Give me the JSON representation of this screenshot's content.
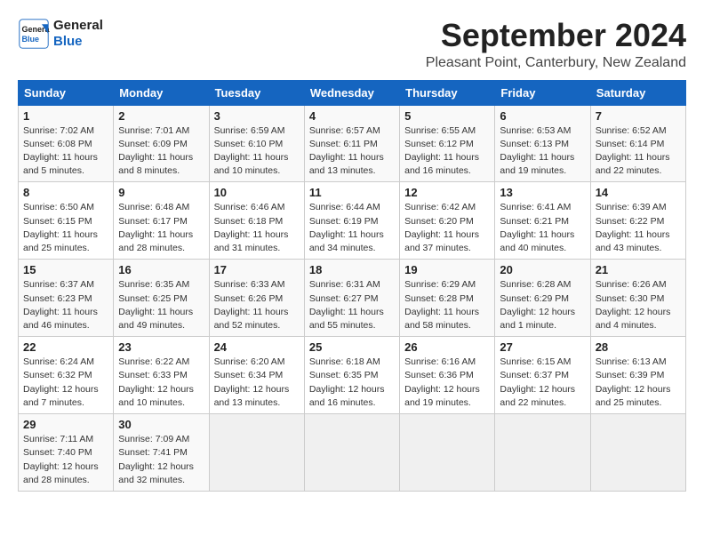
{
  "logo": {
    "line1": "General",
    "line2": "Blue"
  },
  "title": "September 2024",
  "location": "Pleasant Point, Canterbury, New Zealand",
  "days_of_week": [
    "Sunday",
    "Monday",
    "Tuesday",
    "Wednesday",
    "Thursday",
    "Friday",
    "Saturday"
  ],
  "weeks": [
    [
      {
        "day": "1",
        "info": "Sunrise: 7:02 AM\nSunset: 6:08 PM\nDaylight: 11 hours\nand 5 minutes."
      },
      {
        "day": "2",
        "info": "Sunrise: 7:01 AM\nSunset: 6:09 PM\nDaylight: 11 hours\nand 8 minutes."
      },
      {
        "day": "3",
        "info": "Sunrise: 6:59 AM\nSunset: 6:10 PM\nDaylight: 11 hours\nand 10 minutes."
      },
      {
        "day": "4",
        "info": "Sunrise: 6:57 AM\nSunset: 6:11 PM\nDaylight: 11 hours\nand 13 minutes."
      },
      {
        "day": "5",
        "info": "Sunrise: 6:55 AM\nSunset: 6:12 PM\nDaylight: 11 hours\nand 16 minutes."
      },
      {
        "day": "6",
        "info": "Sunrise: 6:53 AM\nSunset: 6:13 PM\nDaylight: 11 hours\nand 19 minutes."
      },
      {
        "day": "7",
        "info": "Sunrise: 6:52 AM\nSunset: 6:14 PM\nDaylight: 11 hours\nand 22 minutes."
      }
    ],
    [
      {
        "day": "8",
        "info": "Sunrise: 6:50 AM\nSunset: 6:15 PM\nDaylight: 11 hours\nand 25 minutes."
      },
      {
        "day": "9",
        "info": "Sunrise: 6:48 AM\nSunset: 6:17 PM\nDaylight: 11 hours\nand 28 minutes."
      },
      {
        "day": "10",
        "info": "Sunrise: 6:46 AM\nSunset: 6:18 PM\nDaylight: 11 hours\nand 31 minutes."
      },
      {
        "day": "11",
        "info": "Sunrise: 6:44 AM\nSunset: 6:19 PM\nDaylight: 11 hours\nand 34 minutes."
      },
      {
        "day": "12",
        "info": "Sunrise: 6:42 AM\nSunset: 6:20 PM\nDaylight: 11 hours\nand 37 minutes."
      },
      {
        "day": "13",
        "info": "Sunrise: 6:41 AM\nSunset: 6:21 PM\nDaylight: 11 hours\nand 40 minutes."
      },
      {
        "day": "14",
        "info": "Sunrise: 6:39 AM\nSunset: 6:22 PM\nDaylight: 11 hours\nand 43 minutes."
      }
    ],
    [
      {
        "day": "15",
        "info": "Sunrise: 6:37 AM\nSunset: 6:23 PM\nDaylight: 11 hours\nand 46 minutes."
      },
      {
        "day": "16",
        "info": "Sunrise: 6:35 AM\nSunset: 6:25 PM\nDaylight: 11 hours\nand 49 minutes."
      },
      {
        "day": "17",
        "info": "Sunrise: 6:33 AM\nSunset: 6:26 PM\nDaylight: 11 hours\nand 52 minutes."
      },
      {
        "day": "18",
        "info": "Sunrise: 6:31 AM\nSunset: 6:27 PM\nDaylight: 11 hours\nand 55 minutes."
      },
      {
        "day": "19",
        "info": "Sunrise: 6:29 AM\nSunset: 6:28 PM\nDaylight: 11 hours\nand 58 minutes."
      },
      {
        "day": "20",
        "info": "Sunrise: 6:28 AM\nSunset: 6:29 PM\nDaylight: 12 hours\nand 1 minute."
      },
      {
        "day": "21",
        "info": "Sunrise: 6:26 AM\nSunset: 6:30 PM\nDaylight: 12 hours\nand 4 minutes."
      }
    ],
    [
      {
        "day": "22",
        "info": "Sunrise: 6:24 AM\nSunset: 6:32 PM\nDaylight: 12 hours\nand 7 minutes."
      },
      {
        "day": "23",
        "info": "Sunrise: 6:22 AM\nSunset: 6:33 PM\nDaylight: 12 hours\nand 10 minutes."
      },
      {
        "day": "24",
        "info": "Sunrise: 6:20 AM\nSunset: 6:34 PM\nDaylight: 12 hours\nand 13 minutes."
      },
      {
        "day": "25",
        "info": "Sunrise: 6:18 AM\nSunset: 6:35 PM\nDaylight: 12 hours\nand 16 minutes."
      },
      {
        "day": "26",
        "info": "Sunrise: 6:16 AM\nSunset: 6:36 PM\nDaylight: 12 hours\nand 19 minutes."
      },
      {
        "day": "27",
        "info": "Sunrise: 6:15 AM\nSunset: 6:37 PM\nDaylight: 12 hours\nand 22 minutes."
      },
      {
        "day": "28",
        "info": "Sunrise: 6:13 AM\nSunset: 6:39 PM\nDaylight: 12 hours\nand 25 minutes."
      }
    ],
    [
      {
        "day": "29",
        "info": "Sunrise: 7:11 AM\nSunset: 7:40 PM\nDaylight: 12 hours\nand 28 minutes."
      },
      {
        "day": "30",
        "info": "Sunrise: 7:09 AM\nSunset: 7:41 PM\nDaylight: 12 hours\nand 32 minutes."
      },
      {
        "day": "",
        "info": ""
      },
      {
        "day": "",
        "info": ""
      },
      {
        "day": "",
        "info": ""
      },
      {
        "day": "",
        "info": ""
      },
      {
        "day": "",
        "info": ""
      }
    ]
  ]
}
